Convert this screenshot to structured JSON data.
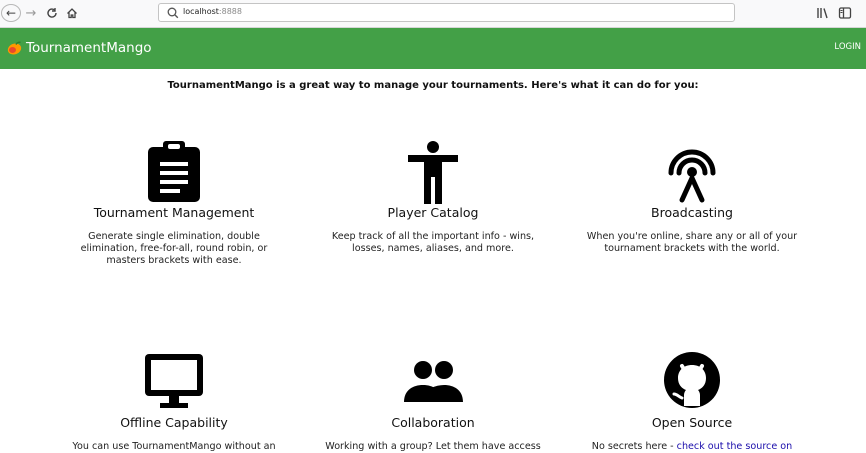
{
  "browser": {
    "url_host": "localhost",
    "url_port": ":8888"
  },
  "appbar": {
    "brand": "TournamentMango",
    "login": "LOGIN"
  },
  "intro": "TournamentMango is a great way to manage your tournaments. Here's what it can do for you:",
  "features": [
    {
      "icon": "clipboard-icon",
      "title": "Tournament Management",
      "desc": "Generate single elimination, double elimination, free-for-all, round robin, or masters brackets with ease."
    },
    {
      "icon": "person-icon",
      "title": "Player Catalog",
      "desc": "Keep track of all the important info - wins, losses, names, aliases, and more."
    },
    {
      "icon": "broadcast-icon",
      "title": "Broadcasting",
      "desc": "When you're online, share any or all of your tournament brackets with the world."
    },
    {
      "icon": "monitor-icon",
      "title": "Offline Capability",
      "desc": "You can use TournamentMango without an"
    },
    {
      "icon": "people-icon",
      "title": "Collaboration",
      "desc": "Working with a group? Let them have access"
    },
    {
      "icon": "github-icon",
      "title": "Open Source",
      "desc": "No secrets here - ",
      "link": "check out the source on"
    }
  ],
  "colors": {
    "appbar": "#43a047",
    "link": "#1a0dab"
  }
}
